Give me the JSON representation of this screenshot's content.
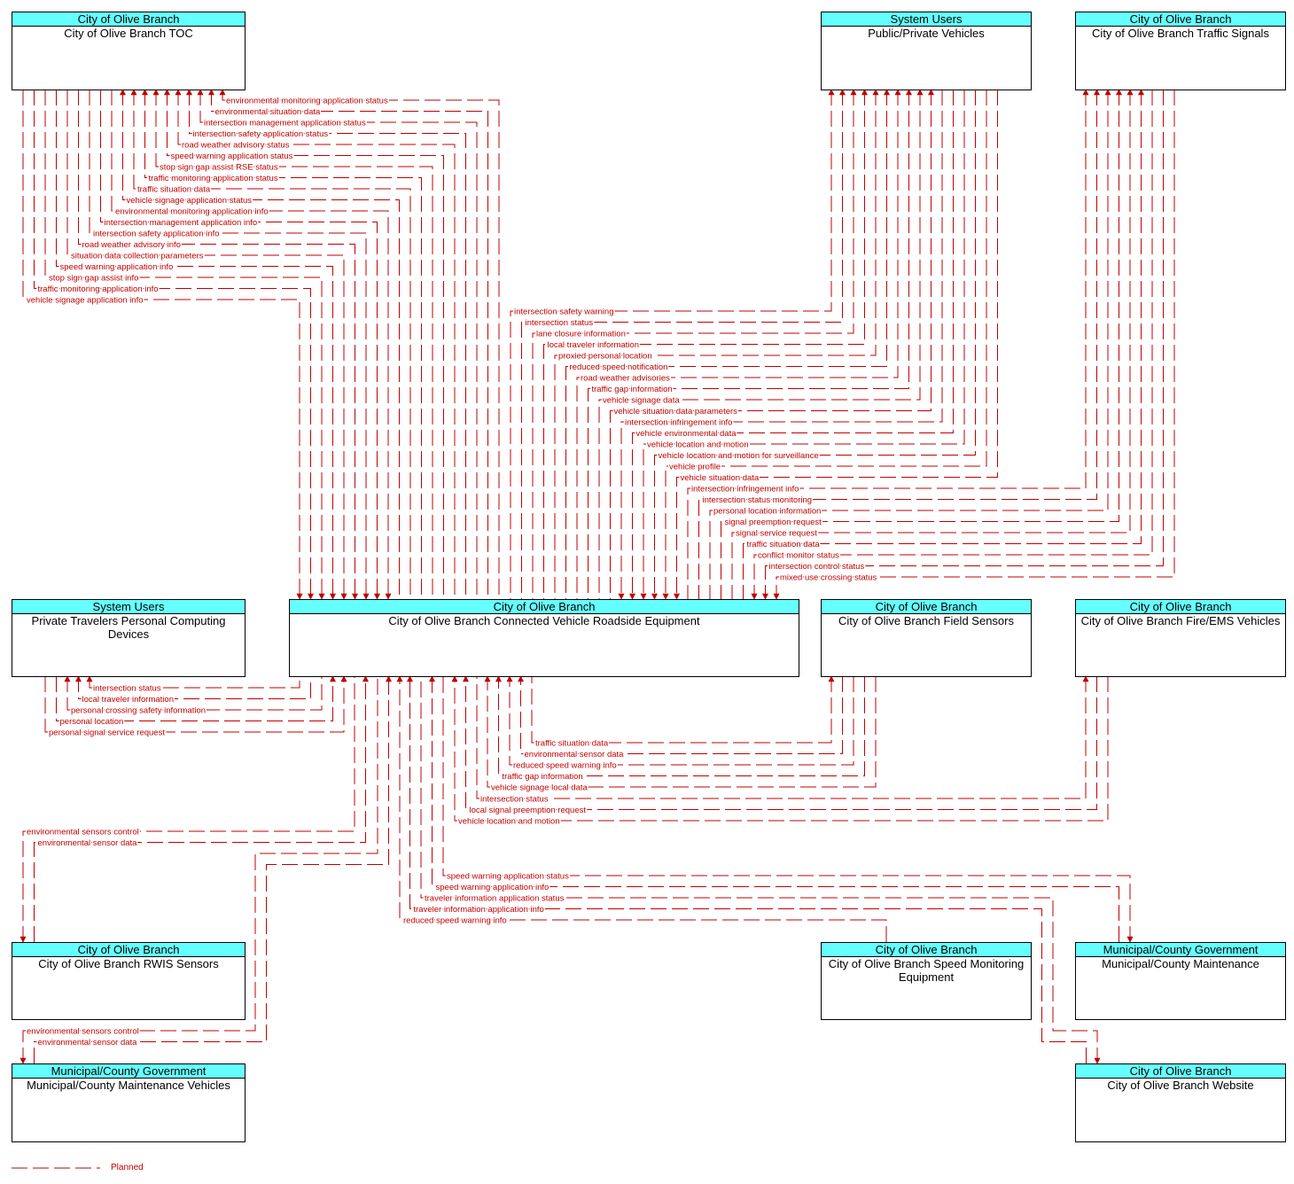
{
  "elements": {
    "toc": {
      "stakeholder": "City of Olive Branch",
      "name": "City of Olive Branch TOC"
    },
    "ppv": {
      "stakeholder": "System Users",
      "name": "Public/Private Vehicles"
    },
    "ts": {
      "stakeholder": "City of Olive Branch",
      "name": "City of Olive Branch Traffic Signals"
    },
    "pt": {
      "stakeholder": "System Users",
      "name": "Private Travelers Personal Computing Devices"
    },
    "rse": {
      "stakeholder": "City of Olive Branch",
      "name": "City of Olive Branch Connected Vehicle Roadside Equipment"
    },
    "fs": {
      "stakeholder": "City of Olive Branch",
      "name": "City of Olive Branch Field Sensors"
    },
    "ems": {
      "stakeholder": "City of Olive Branch",
      "name": "City of Olive Branch Fire/EMS Vehicles"
    },
    "rwis": {
      "stakeholder": "City of Olive Branch",
      "name": "City of Olive Branch RWIS Sensors"
    },
    "sme": {
      "stakeholder": "City of Olive Branch",
      "name": "City of Olive Branch Speed Monitoring Equipment"
    },
    "muni": {
      "stakeholder": "Municipal/County Government",
      "name": "Municipal/County Maintenance"
    },
    "mv": {
      "stakeholder": "Municipal/County Government",
      "name": "Municipal/County Maintenance Vehicles"
    },
    "web": {
      "stakeholder": "City of Olive Branch",
      "name": "City of Olive Branch Website"
    }
  },
  "flow_groups": {
    "toc_rse": [
      {
        "label": "environmental monitoring application status",
        "from": "rse",
        "to": "toc"
      },
      {
        "label": "environmental situation data",
        "from": "rse",
        "to": "toc"
      },
      {
        "label": "intersection management application status",
        "from": "rse",
        "to": "toc"
      },
      {
        "label": "intersection safety application status",
        "from": "rse",
        "to": "toc"
      },
      {
        "label": "road weather advisory status",
        "from": "rse",
        "to": "toc"
      },
      {
        "label": "speed warning application status",
        "from": "rse",
        "to": "toc"
      },
      {
        "label": "stop sign gap assist RSE status",
        "from": "rse",
        "to": "toc"
      },
      {
        "label": "traffic monitoring application status",
        "from": "rse",
        "to": "toc"
      },
      {
        "label": "traffic situation data",
        "from": "rse",
        "to": "toc"
      },
      {
        "label": "vehicle signage application status",
        "from": "rse",
        "to": "toc"
      },
      {
        "label": "environmental monitoring application info",
        "from": "toc",
        "to": "rse"
      },
      {
        "label": "intersection management application info",
        "from": "toc",
        "to": "rse"
      },
      {
        "label": "intersection safety application info",
        "from": "toc",
        "to": "rse"
      },
      {
        "label": "road weather advisory info",
        "from": "toc",
        "to": "rse"
      },
      {
        "label": "situation data collection parameters",
        "from": "toc",
        "to": "rse"
      },
      {
        "label": "speed warning application info",
        "from": "toc",
        "to": "rse"
      },
      {
        "label": "stop sign gap assist info",
        "from": "toc",
        "to": "rse"
      },
      {
        "label": "traffic monitoring application info",
        "from": "toc",
        "to": "rse"
      },
      {
        "label": "vehicle signage application info",
        "from": "toc",
        "to": "rse"
      }
    ],
    "ppv_rse": [
      {
        "label": "intersection safety warning",
        "from": "rse",
        "to": "ppv"
      },
      {
        "label": "intersection status",
        "from": "rse",
        "to": "ppv"
      },
      {
        "label": "lane closure information",
        "from": "rse",
        "to": "ppv"
      },
      {
        "label": "local traveler information",
        "from": "rse",
        "to": "ppv"
      },
      {
        "label": "proxied personal location",
        "from": "rse",
        "to": "ppv"
      },
      {
        "label": "reduced speed notification",
        "from": "rse",
        "to": "ppv"
      },
      {
        "label": "road weather advisories",
        "from": "rse",
        "to": "ppv"
      },
      {
        "label": "traffic gap information",
        "from": "rse",
        "to": "ppv"
      },
      {
        "label": "vehicle signage data",
        "from": "rse",
        "to": "ppv"
      },
      {
        "label": "vehicle situation data parameters",
        "from": "rse",
        "to": "ppv"
      },
      {
        "label": "intersection infringement info",
        "from": "ppv",
        "to": "rse"
      },
      {
        "label": "vehicle environmental data",
        "from": "ppv",
        "to": "rse"
      },
      {
        "label": "vehicle location and motion",
        "from": "ppv",
        "to": "rse"
      },
      {
        "label": "vehicle location and motion for surveillance",
        "from": "ppv",
        "to": "rse"
      },
      {
        "label": "vehicle profile",
        "from": "ppv",
        "to": "rse"
      },
      {
        "label": "vehicle situation data",
        "from": "ppv",
        "to": "rse"
      }
    ],
    "ts_rse": [
      {
        "label": "intersection infringement info",
        "from": "rse",
        "to": "ts"
      },
      {
        "label": "intersection status monitoring",
        "from": "rse",
        "to": "ts"
      },
      {
        "label": "personal location information",
        "from": "rse",
        "to": "ts"
      },
      {
        "label": "signal preemption request",
        "from": "rse",
        "to": "ts"
      },
      {
        "label": "signal service request",
        "from": "rse",
        "to": "ts"
      },
      {
        "label": "traffic situation data",
        "from": "rse",
        "to": "ts"
      },
      {
        "label": "conflict monitor status",
        "from": "ts",
        "to": "rse"
      },
      {
        "label": "intersection control status",
        "from": "ts",
        "to": "rse"
      },
      {
        "label": "mixed use crossing status",
        "from": "ts",
        "to": "rse"
      }
    ],
    "pt_rse": [
      {
        "label": "intersection status",
        "from": "rse",
        "to": "pt"
      },
      {
        "label": "local traveler information",
        "from": "rse",
        "to": "pt"
      },
      {
        "label": "personal crossing safety information",
        "from": "rse",
        "to": "pt"
      },
      {
        "label": "personal location",
        "from": "pt",
        "to": "rse"
      },
      {
        "label": "personal signal service request",
        "from": "pt",
        "to": "rse"
      }
    ],
    "fs_rse": [
      {
        "label": "traffic situation data",
        "from": "rse",
        "to": "fs"
      },
      {
        "label": "environmental sensor data",
        "from": "fs",
        "to": "rse"
      },
      {
        "label": "reduced speed warning info",
        "from": "fs",
        "to": "rse"
      },
      {
        "label": "traffic gap information",
        "from": "fs",
        "to": "rse"
      },
      {
        "label": "vehicle signage local data",
        "from": "fs",
        "to": "rse"
      }
    ],
    "ems_rse": [
      {
        "label": "intersection status",
        "from": "rse",
        "to": "ems"
      },
      {
        "label": "local signal preemption request",
        "from": "ems",
        "to": "rse"
      },
      {
        "label": "vehicle location and motion",
        "from": "ems",
        "to": "rse"
      }
    ],
    "rwis_rse": [
      {
        "label": "environmental sensors control",
        "from": "rse",
        "to": "rwis"
      },
      {
        "label": "environmental sensor data",
        "from": "rwis",
        "to": "rse"
      }
    ],
    "mv_rse": [
      {
        "label": "environmental sensors control",
        "from": "rse",
        "to": "mv"
      },
      {
        "label": "environmental sensor data",
        "from": "mv",
        "to": "rse"
      }
    ],
    "muni_rse": [
      {
        "label": "speed warning application status",
        "from": "rse",
        "to": "muni"
      },
      {
        "label": "speed warning application info",
        "from": "muni",
        "to": "rse"
      }
    ],
    "web_rse": [
      {
        "label": "traveler information application status",
        "from": "rse",
        "to": "web"
      },
      {
        "label": "traveler information application info",
        "from": "web",
        "to": "rse"
      }
    ],
    "sme_rse": [
      {
        "label": "reduced speed warning info",
        "from": "sme",
        "to": "rse"
      }
    ]
  },
  "legend": {
    "label": "Planned",
    "line_style": "dashed",
    "color": "#c00000"
  },
  "colors": {
    "flow": "#c00000",
    "header": "#66ffff"
  }
}
